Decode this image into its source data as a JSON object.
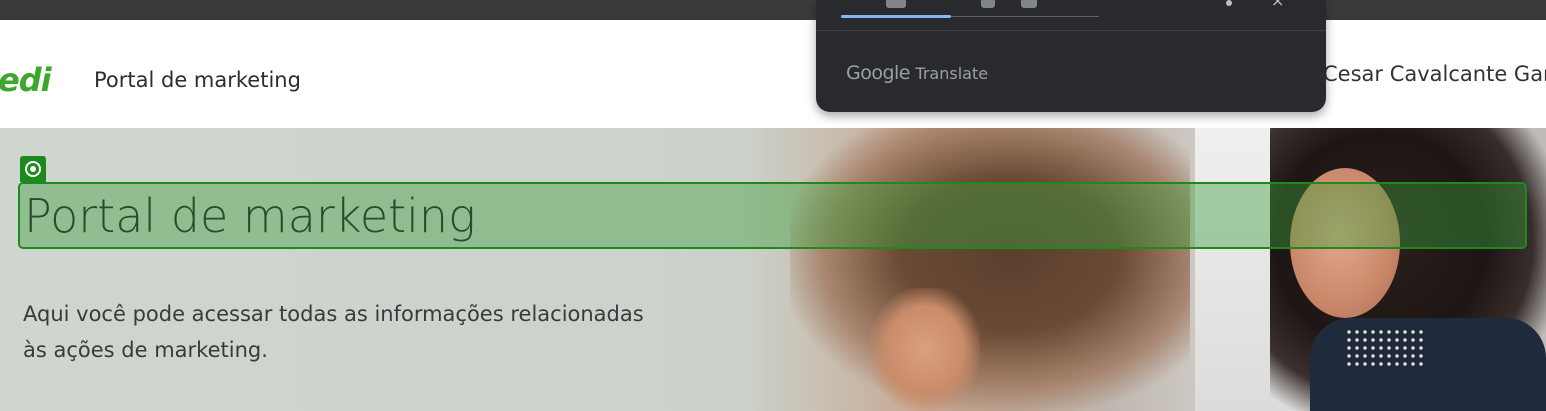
{
  "header": {
    "logo_text": "edi",
    "title": "Portal de marketing",
    "user_name": "Cesar Cavalcante Gar"
  },
  "hero": {
    "title": "Portal de marketing",
    "description": "Aqui você pode acessar todas as informações relacionadas às ações de marketing."
  },
  "translate_popup": {
    "brand_google": "Google",
    "brand_translate": "Translate"
  },
  "colors": {
    "brand_green": "#3aa82a",
    "highlight_green": "#1e8a1e",
    "popup_bg": "#292a2d",
    "popup_accent": "#8ab4f8"
  },
  "icons": {
    "badge": "target-icon",
    "menu": "more-vert-icon",
    "close": "close-icon"
  }
}
